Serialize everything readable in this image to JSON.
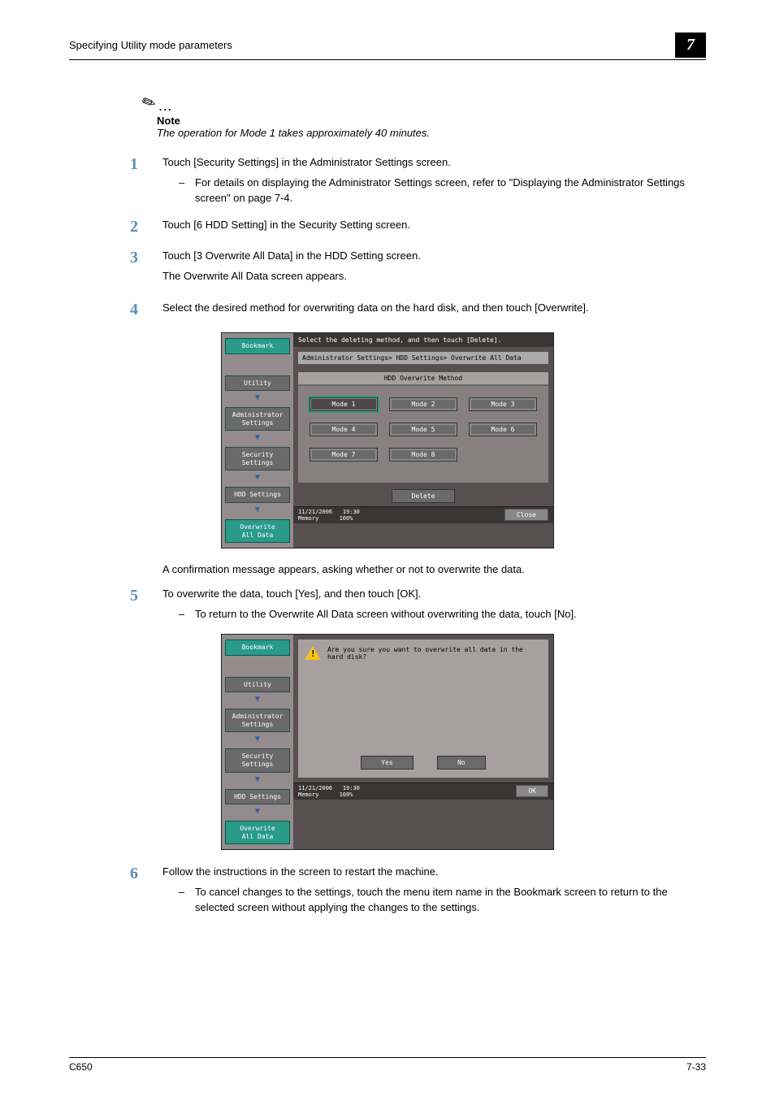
{
  "header": {
    "title": "Specifying Utility mode parameters",
    "chapter": "7"
  },
  "note": {
    "label": "Note",
    "text": "The operation for Mode 1 takes approximately 40 minutes."
  },
  "steps": {
    "s1": {
      "num": "1",
      "text": "Touch [Security Settings] in the Administrator Settings screen.",
      "sub": "For details on displaying the Administrator Settings screen, refer to \"Displaying the Administrator Settings screen\" on page 7-4."
    },
    "s2": {
      "num": "2",
      "text": "Touch [6 HDD Setting] in the Security Setting screen."
    },
    "s3": {
      "num": "3",
      "text": "Touch [3 Overwrite All Data] in the HDD Setting screen.",
      "after": "The Overwrite All Data screen appears."
    },
    "s4": {
      "num": "4",
      "text": "Select the desired method for overwriting data on the hard disk, and then touch [Overwrite]."
    },
    "between4": "A confirmation message appears, asking whether or not to overwrite the data.",
    "s5": {
      "num": "5",
      "text": "To overwrite the data, touch [Yes], and then touch [OK].",
      "sub": "To return to the Overwrite All Data screen without overwriting the data, touch [No]."
    },
    "s6": {
      "num": "6",
      "text": "Follow the instructions in the screen to restart the machine.",
      "sub": "To cancel changes to the settings, touch the menu item name in the Bookmark screen to return to the selected screen without applying the changes to the settings."
    }
  },
  "screen1": {
    "topbar": "Select the deleting method, and then touch [Delete].",
    "breadcrumb": "Administrator Settings> HDD Settings> Overwrite All Data",
    "panel_title": "HDD Overwrite Method",
    "sidebar": {
      "bookmark": "Bookmark",
      "utility": "Utility",
      "admin": "Administrator\nSettings",
      "security": "Security\nSettings",
      "hdd": "HDD Settings",
      "overwrite": "Overwrite\nAll Data"
    },
    "modes": {
      "m1": "Mode 1",
      "m2": "Mode 2",
      "m3": "Mode 3",
      "m4": "Mode 4",
      "m5": "Mode 5",
      "m6": "Mode 6",
      "m7": "Mode 7",
      "m8": "Mode 8"
    },
    "delete": "Delete",
    "status_date": "11/21/2006",
    "status_time": "19:30",
    "status_mem_label": "Memory",
    "status_mem": "100%",
    "close": "Close"
  },
  "screen2": {
    "question": "Are you sure you want to overwrite all data in the hard disk?",
    "yes": "Yes",
    "no": "No",
    "ok": "OK"
  },
  "footer": {
    "left": "C650",
    "right": "7-33"
  }
}
